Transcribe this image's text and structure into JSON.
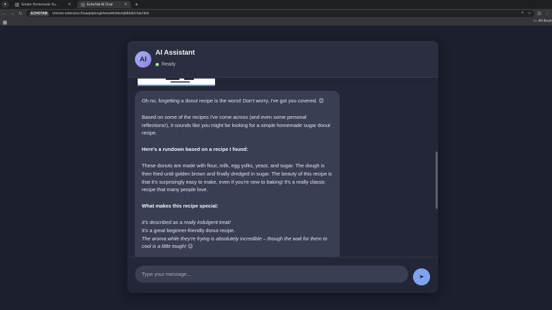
{
  "browser": {
    "tabs": [
      {
        "label": "Simple Homemade Su...",
        "active": false
      },
      {
        "label": "EchoTab AI Chat",
        "active": true
      }
    ],
    "address": {
      "site_chip": "ECHOTAB",
      "url": "chrome-extension://maejelpmcgkhemebfcbkmkjfdbfab/chat.html"
    },
    "bookmarks": {
      "all_label": "All Book"
    }
  },
  "chat": {
    "avatar_initials": "AI",
    "title": "AI Assistant",
    "status": "Ready",
    "message": {
      "p1": "Oh no, forgetting a donut recipe is the worst! Don't worry, I've got you covered. 😊",
      "p2": "Based on some of the recipes I've come across (and even some personal reflections!), it sounds like you might be looking for a simple homemade sugar donut recipe.",
      "h1": "Here's a rundown based on a recipe I found:",
      "p3": "These donuts are made with flour, milk, egg yolks, yeast, and sugar. The dough is then fried until golden brown and finally dredged in sugar. The beauty of this recipe is that it's surprisingly easy to make, even if you're new to baking! It's a really classic recipe that many people love.",
      "h2": "What makes this recipe special:",
      "li1": "It's described as a really indulgent treat!",
      "li2": "It's a great beginner-friendly donut recipe.",
      "li3": "The aroma while they're frying is absolutely incredible – though the wait for them to cool is a little tough! 😉"
    },
    "input": {
      "placeholder": "Type your message..."
    },
    "send_icon": "➤"
  },
  "colors": {
    "background": "#1b1f2e",
    "panel": "#232636",
    "bubble": "#3a3e53",
    "accent": "#7ea3f1",
    "status_ok": "#9be49a"
  }
}
